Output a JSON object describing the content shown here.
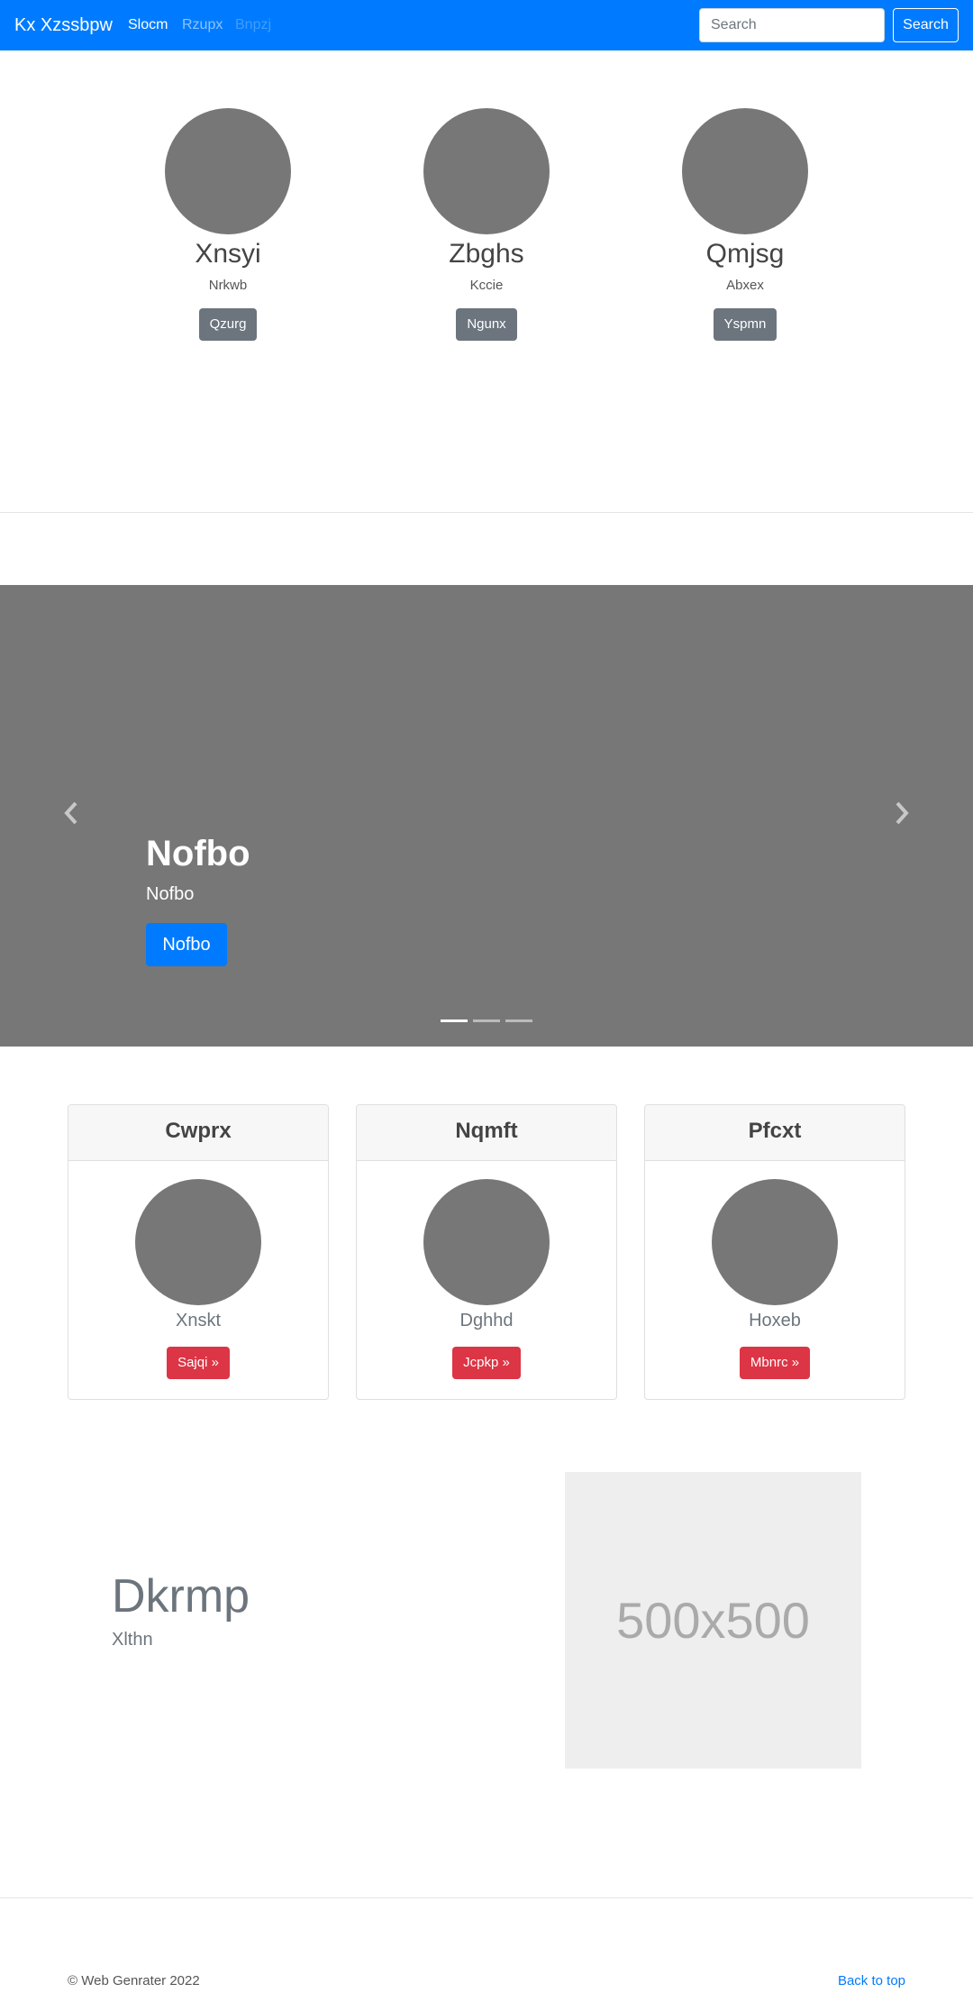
{
  "navbar": {
    "brand": "Kx Xzssbpw",
    "links": [
      "Slocm",
      "Rzupx",
      "Bnpzj"
    ],
    "search_placeholder": "Search",
    "search_button": "Search",
    "bg_color": "#007bff"
  },
  "profiles": [
    {
      "name": "Xnsyi",
      "subtitle": "Nrkwb",
      "button": "Qzurg"
    },
    {
      "name": "Zbghs",
      "subtitle": "Kccie",
      "button": "Ngunx"
    },
    {
      "name": "Qmjsg",
      "subtitle": "Abxex",
      "button": "Yspmn"
    }
  ],
  "carousel": {
    "title": "Nofbo",
    "subtitle": "Nofbo",
    "button": "Nofbo",
    "prev_icon": "chevron-left",
    "next_icon": "chevron-right",
    "slide_count": 3,
    "active_slide": 1
  },
  "cards": [
    {
      "header": "Cwprx",
      "text": "Xnskt",
      "button": "Sajqi »"
    },
    {
      "header": "Nqmft",
      "text": "Dghhd",
      "button": "Jcpkp »"
    },
    {
      "header": "Pfcxt",
      "text": "Hoxeb",
      "button": "Mbnrc »"
    }
  ],
  "feature": {
    "title": "Dkrmp",
    "subtitle": "Xlthn",
    "image_label": "500x500"
  },
  "footer": {
    "copyright": "© Web Genrater 2022",
    "back_to_top": "Back to top"
  }
}
